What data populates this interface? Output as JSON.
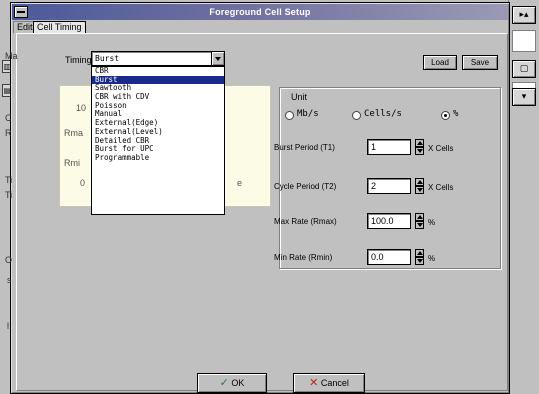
{
  "window": {
    "title": "Foreground Cell Setup",
    "tabs": [
      "Edit",
      "Cell Timing"
    ]
  },
  "timing": {
    "label": "Timing",
    "selected": "Burst",
    "options": [
      "CBR",
      "Burst",
      "Sawtooth",
      "CBR with CDV",
      "Poisson",
      "Manual",
      "External(Edge)",
      "External(Level)",
      "Detailed CBR",
      "Burst for UPC",
      "Programmable"
    ],
    "selected_index": 1
  },
  "buttons": {
    "load": "Load",
    "save": "Save",
    "ok": "OK",
    "cancel": "Cancel"
  },
  "unit_group": {
    "title": "Unit",
    "options": [
      {
        "label": "Mb/s",
        "selected": false
      },
      {
        "label": "Cells/s",
        "selected": false
      },
      {
        "label": "%",
        "selected": true
      }
    ]
  },
  "fields": [
    {
      "label": "Burst Period (T1)",
      "value": "1",
      "unit": "X Cells"
    },
    {
      "label": "Cycle Period (T2)",
      "value": "2",
      "unit": "X Cells"
    },
    {
      "label": "Max Rate (Rmax)",
      "value": "100.0",
      "unit": "%"
    },
    {
      "label": "Min Rate (Rmin)",
      "value": "0.0",
      "unit": "%"
    }
  ],
  "background_fragments": {
    "yellow_left_1": "10",
    "yellow_left_2": "Rma",
    "yellow_left_3": "Rmi",
    "yellow_left_4": "0",
    "yellow_right_1": "e",
    "left_1": "Ma",
    "left_2": "C",
    "left_3": "R",
    "left_4": "Ti",
    "left_5": "Ti",
    "left_6": "O",
    "left_7": "s",
    "left_8": "l"
  }
}
